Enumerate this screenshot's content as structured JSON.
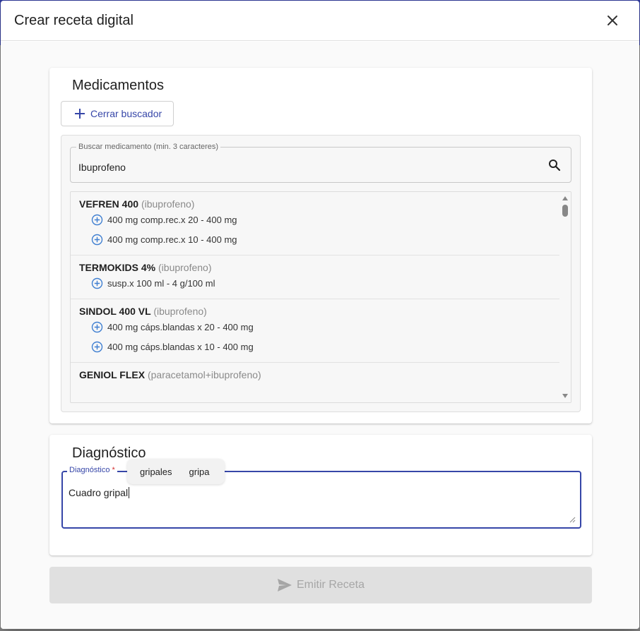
{
  "dialog": {
    "title": "Crear receta digital",
    "close_icon": "close-icon"
  },
  "medications": {
    "section_title": "Medicamentos",
    "toggle_search_label": "Cerrar buscador",
    "search": {
      "label": "Buscar medicamento (min. 3 caracteres)",
      "value": "Ibuprofeno",
      "icon": "search-icon"
    },
    "results": [
      {
        "name": "VEFREN 400",
        "generic": "(ibuprofeno)",
        "presentations": [
          "400 mg comp.rec.x 20 - 400 mg",
          "400 mg comp.rec.x 10 - 400 mg"
        ]
      },
      {
        "name": "TERMOKIDS 4%",
        "generic": "(ibuprofeno)",
        "presentations": [
          "susp.x 100 ml - 4 g/100 ml"
        ]
      },
      {
        "name": "SINDOL 400 VL",
        "generic": "(ibuprofeno)",
        "presentations": [
          "400 mg cáps.blandas x 20 - 400 mg",
          "400 mg cáps.blandas x 10 - 400 mg"
        ]
      },
      {
        "name": "GENIOL FLEX",
        "generic": "(paracetamol+ibuprofeno)",
        "presentations": []
      }
    ]
  },
  "diagnosis": {
    "section_title": "Diagnóstico",
    "field_label": "Diagnóstico",
    "required_mark": "*",
    "value": "Cuadro gripal",
    "suggestions": [
      "gripales",
      "gripa"
    ]
  },
  "submit": {
    "label": "Emitir Receta",
    "icon": "send-icon"
  },
  "colors": {
    "primary": "#3646a8",
    "required": "#d32f2f",
    "disabled_bg": "#e0e0e0",
    "disabled_text": "#a6a6a6"
  }
}
